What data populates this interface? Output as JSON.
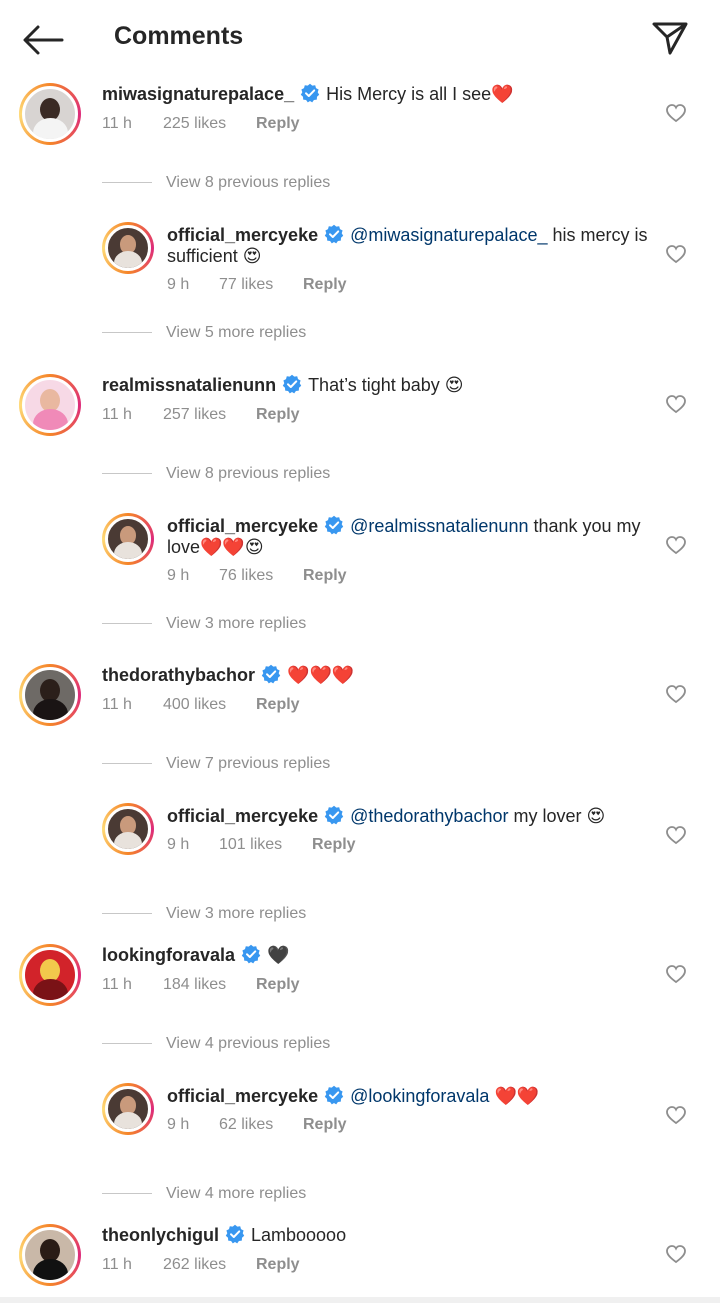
{
  "header": {
    "title": "Comments"
  },
  "comments": [
    {
      "username": "miwasignaturepalace_",
      "text": "His Mercy is all I see❤️",
      "time": "11 h",
      "likes": "225 likes",
      "reply": "Reply",
      "view_replies": "View 8 previous replies",
      "avatar_colors": {
        "bg": "#d8d4d2",
        "face": "#3a2a24",
        "body": "#f4f4f4"
      },
      "reply_item": {
        "username": "official_mercyeke",
        "mention": "@miwasignaturepalace_",
        "text1": " his mercy is",
        "text2": "sufficient 😍",
        "time": "9 h",
        "likes": "77 likes",
        "reply": "Reply"
      },
      "view_more": "View 5 more replies"
    },
    {
      "username": "realmissnatalienunn",
      "text": "That’s tight baby 😍",
      "time": "11 h",
      "likes": "257 likes",
      "reply": "Reply",
      "view_replies": "View 8 previous replies",
      "avatar_colors": {
        "bg": "#f7d9e6",
        "face": "#e9b8a0",
        "body": "#f08ab8"
      },
      "reply_item": {
        "username": "official_mercyeke",
        "mention": "@realmissnatalienunn",
        "text1": " thank you my",
        "text2": "love❤️❤️😍",
        "time": "9 h",
        "likes": "76 likes",
        "reply": "Reply"
      },
      "view_more": "View 3 more replies"
    },
    {
      "username": "thedorathybachor",
      "text": "❤️❤️❤️",
      "time": "11 h",
      "likes": "400 likes",
      "reply": "Reply",
      "view_replies": "View 7 previous replies",
      "avatar_colors": {
        "bg": "#6e6a66",
        "face": "#2b1f1a",
        "body": "#1a1414"
      },
      "reply_item": {
        "username": "official_mercyeke",
        "mention": "@thedorathybachor",
        "text1": " my lover 😍",
        "text2": "",
        "time": "9 h",
        "likes": "101 likes",
        "reply": "Reply"
      },
      "view_more": "View 3 more replies"
    },
    {
      "username": "lookingforavala",
      "text": "🖤",
      "time": "11 h",
      "likes": "184 likes",
      "reply": "Reply",
      "view_replies": "View 4 previous replies",
      "avatar_colors": {
        "bg": "#d2232a",
        "face": "#f2c94c",
        "body": "#7a1216"
      },
      "reply_item": {
        "username": "official_mercyeke",
        "mention": "@lookingforavala",
        "text1": " ❤️❤️",
        "text2": "",
        "time": "9 h",
        "likes": "62 likes",
        "reply": "Reply"
      },
      "view_more": "View 4 more replies"
    },
    {
      "username": "theonlychigul",
      "text": "Lambooooo",
      "time": "11 h",
      "likes": "262 likes",
      "reply": "Reply",
      "avatar_colors": {
        "bg": "#c9b8a8",
        "face": "#2a1c16",
        "body": "#111111"
      }
    }
  ],
  "reply_avatar_colors": {
    "bg": "#4a3a34",
    "face": "#c99a7c",
    "body": "#e8e2dc"
  },
  "colors": {
    "verified": "#3897f0",
    "mention": "#00376b",
    "meta": "#8e8e8e"
  }
}
